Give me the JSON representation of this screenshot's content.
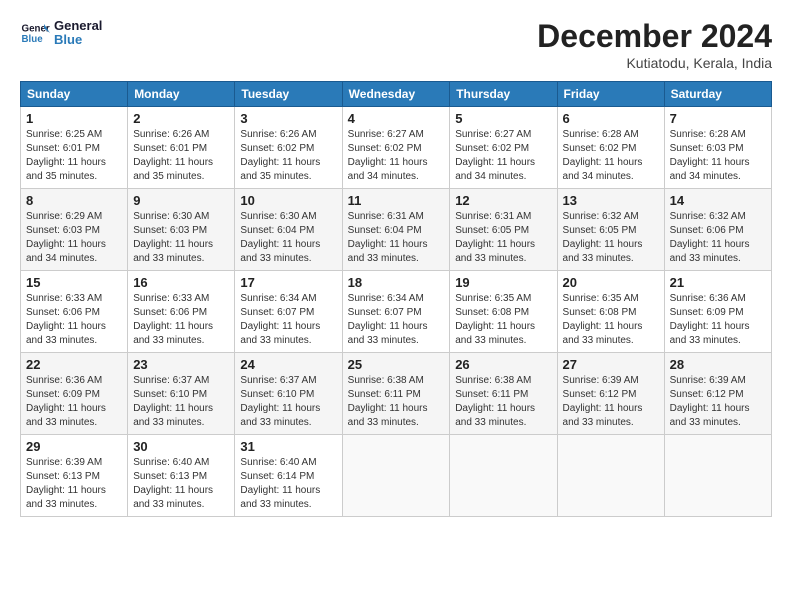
{
  "header": {
    "logo_line1": "General",
    "logo_line2": "Blue",
    "month_title": "December 2024",
    "location": "Kutiatodu, Kerala, India"
  },
  "days_of_week": [
    "Sunday",
    "Monday",
    "Tuesday",
    "Wednesday",
    "Thursday",
    "Friday",
    "Saturday"
  ],
  "weeks": [
    [
      {
        "day": "1",
        "info": "Sunrise: 6:25 AM\nSunset: 6:01 PM\nDaylight: 11 hours\nand 35 minutes."
      },
      {
        "day": "2",
        "info": "Sunrise: 6:26 AM\nSunset: 6:01 PM\nDaylight: 11 hours\nand 35 minutes."
      },
      {
        "day": "3",
        "info": "Sunrise: 6:26 AM\nSunset: 6:02 PM\nDaylight: 11 hours\nand 35 minutes."
      },
      {
        "day": "4",
        "info": "Sunrise: 6:27 AM\nSunset: 6:02 PM\nDaylight: 11 hours\nand 34 minutes."
      },
      {
        "day": "5",
        "info": "Sunrise: 6:27 AM\nSunset: 6:02 PM\nDaylight: 11 hours\nand 34 minutes."
      },
      {
        "day": "6",
        "info": "Sunrise: 6:28 AM\nSunset: 6:02 PM\nDaylight: 11 hours\nand 34 minutes."
      },
      {
        "day": "7",
        "info": "Sunrise: 6:28 AM\nSunset: 6:03 PM\nDaylight: 11 hours\nand 34 minutes."
      }
    ],
    [
      {
        "day": "8",
        "info": "Sunrise: 6:29 AM\nSunset: 6:03 PM\nDaylight: 11 hours\nand 34 minutes."
      },
      {
        "day": "9",
        "info": "Sunrise: 6:30 AM\nSunset: 6:03 PM\nDaylight: 11 hours\nand 33 minutes."
      },
      {
        "day": "10",
        "info": "Sunrise: 6:30 AM\nSunset: 6:04 PM\nDaylight: 11 hours\nand 33 minutes."
      },
      {
        "day": "11",
        "info": "Sunrise: 6:31 AM\nSunset: 6:04 PM\nDaylight: 11 hours\nand 33 minutes."
      },
      {
        "day": "12",
        "info": "Sunrise: 6:31 AM\nSunset: 6:05 PM\nDaylight: 11 hours\nand 33 minutes."
      },
      {
        "day": "13",
        "info": "Sunrise: 6:32 AM\nSunset: 6:05 PM\nDaylight: 11 hours\nand 33 minutes."
      },
      {
        "day": "14",
        "info": "Sunrise: 6:32 AM\nSunset: 6:06 PM\nDaylight: 11 hours\nand 33 minutes."
      }
    ],
    [
      {
        "day": "15",
        "info": "Sunrise: 6:33 AM\nSunset: 6:06 PM\nDaylight: 11 hours\nand 33 minutes."
      },
      {
        "day": "16",
        "info": "Sunrise: 6:33 AM\nSunset: 6:06 PM\nDaylight: 11 hours\nand 33 minutes."
      },
      {
        "day": "17",
        "info": "Sunrise: 6:34 AM\nSunset: 6:07 PM\nDaylight: 11 hours\nand 33 minutes."
      },
      {
        "day": "18",
        "info": "Sunrise: 6:34 AM\nSunset: 6:07 PM\nDaylight: 11 hours\nand 33 minutes."
      },
      {
        "day": "19",
        "info": "Sunrise: 6:35 AM\nSunset: 6:08 PM\nDaylight: 11 hours\nand 33 minutes."
      },
      {
        "day": "20",
        "info": "Sunrise: 6:35 AM\nSunset: 6:08 PM\nDaylight: 11 hours\nand 33 minutes."
      },
      {
        "day": "21",
        "info": "Sunrise: 6:36 AM\nSunset: 6:09 PM\nDaylight: 11 hours\nand 33 minutes."
      }
    ],
    [
      {
        "day": "22",
        "info": "Sunrise: 6:36 AM\nSunset: 6:09 PM\nDaylight: 11 hours\nand 33 minutes."
      },
      {
        "day": "23",
        "info": "Sunrise: 6:37 AM\nSunset: 6:10 PM\nDaylight: 11 hours\nand 33 minutes."
      },
      {
        "day": "24",
        "info": "Sunrise: 6:37 AM\nSunset: 6:10 PM\nDaylight: 11 hours\nand 33 minutes."
      },
      {
        "day": "25",
        "info": "Sunrise: 6:38 AM\nSunset: 6:11 PM\nDaylight: 11 hours\nand 33 minutes."
      },
      {
        "day": "26",
        "info": "Sunrise: 6:38 AM\nSunset: 6:11 PM\nDaylight: 11 hours\nand 33 minutes."
      },
      {
        "day": "27",
        "info": "Sunrise: 6:39 AM\nSunset: 6:12 PM\nDaylight: 11 hours\nand 33 minutes."
      },
      {
        "day": "28",
        "info": "Sunrise: 6:39 AM\nSunset: 6:12 PM\nDaylight: 11 hours\nand 33 minutes."
      }
    ],
    [
      {
        "day": "29",
        "info": "Sunrise: 6:39 AM\nSunset: 6:13 PM\nDaylight: 11 hours\nand 33 minutes."
      },
      {
        "day": "30",
        "info": "Sunrise: 6:40 AM\nSunset: 6:13 PM\nDaylight: 11 hours\nand 33 minutes."
      },
      {
        "day": "31",
        "info": "Sunrise: 6:40 AM\nSunset: 6:14 PM\nDaylight: 11 hours\nand 33 minutes."
      },
      {
        "day": "",
        "info": ""
      },
      {
        "day": "",
        "info": ""
      },
      {
        "day": "",
        "info": ""
      },
      {
        "day": "",
        "info": ""
      }
    ]
  ]
}
